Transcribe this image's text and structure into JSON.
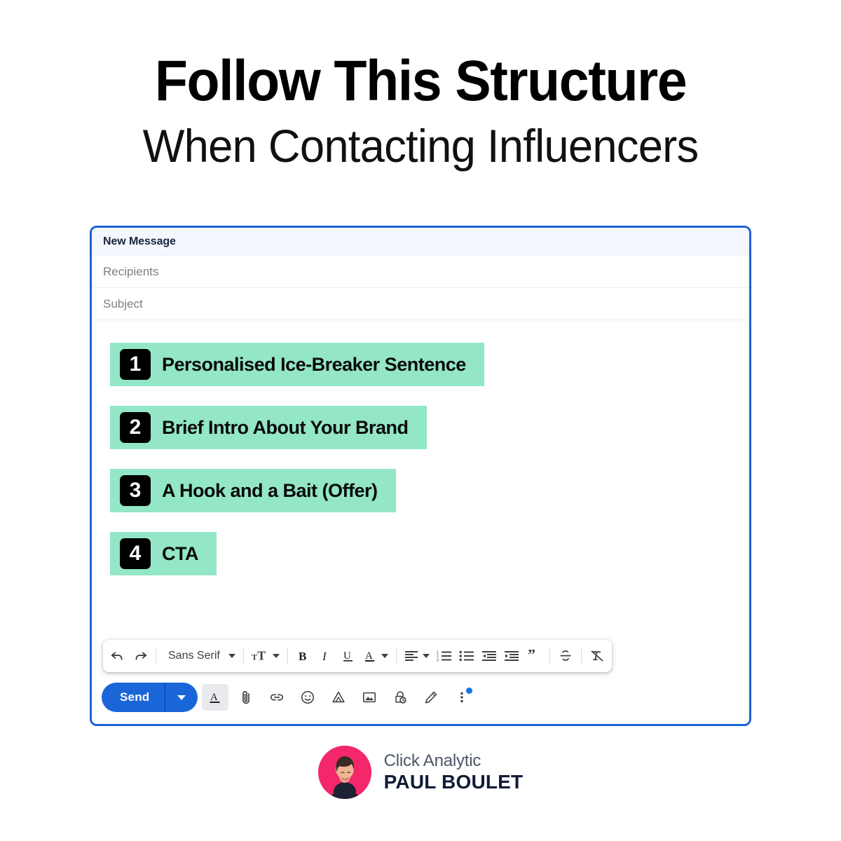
{
  "headline": {
    "line1": "Follow This Structure",
    "line2": "When Contacting Influencers"
  },
  "compose": {
    "title": "New Message",
    "recipients_placeholder": "Recipients",
    "subject_placeholder": "Subject",
    "steps": [
      {
        "number": "1",
        "label": "Personalised Ice-Breaker Sentence"
      },
      {
        "number": "2",
        "label": "Brief Intro About Your Brand"
      },
      {
        "number": "3",
        "label": "A Hook and a Bait (Offer)"
      },
      {
        "number": "4",
        "label": "CTA"
      }
    ],
    "format_toolbar": {
      "undo": "undo-icon",
      "redo": "redo-icon",
      "font_family": "Sans Serif",
      "font_size": "font-size-icon",
      "bold": "B",
      "italic": "I",
      "underline": "U",
      "text_color": "A",
      "align": "align-left-icon",
      "numbered_list": "numbered-list-icon",
      "bulleted_list": "bulleted-list-icon",
      "indent_less": "indent-decrease-icon",
      "indent_more": "indent-increase-icon",
      "quote": "block-quote-icon",
      "strikethrough": "strikethrough-icon",
      "remove_formatting": "remove-formatting-icon"
    },
    "send_bar": {
      "send_label": "Send",
      "send_options": "send-options-caret",
      "formatting": "formatting-options-icon",
      "attach": "attach-file-icon",
      "link": "insert-link-icon",
      "emoji": "insert-emoji-icon",
      "drive": "insert-from-drive-icon",
      "photo": "insert-photo-icon",
      "confidential": "confidential-mode-icon",
      "signature": "insert-signature-icon",
      "more": "more-options-icon"
    }
  },
  "footer": {
    "brand": "Click Analytic",
    "author": "PAUL BOULET"
  },
  "colors": {
    "accent_blue": "#1a66d9",
    "highlight_mint": "#93e6c6",
    "badge_black": "#000000",
    "avatar_pink": "#f5276b",
    "author_navy": "#111c38"
  }
}
